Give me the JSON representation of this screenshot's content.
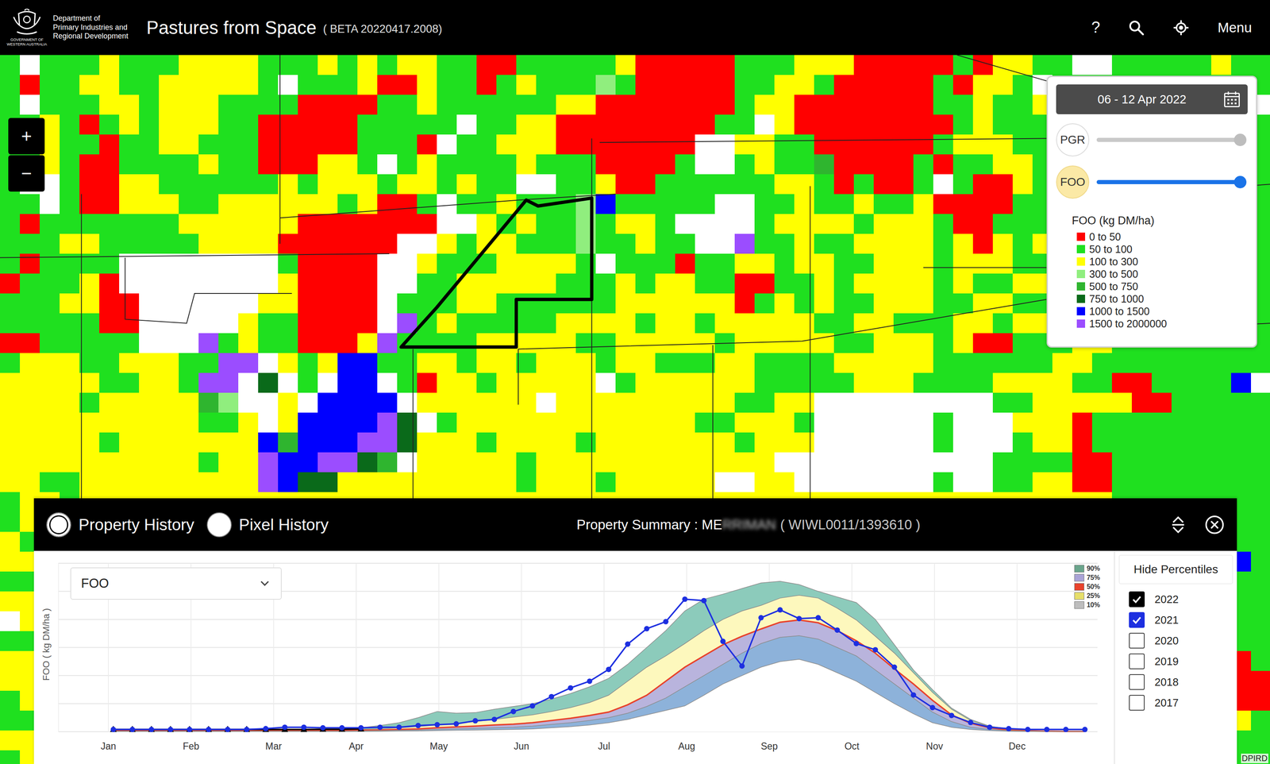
{
  "header": {
    "agency": {
      "lines": [
        "Department of",
        "Primary Industries and",
        "Regional Development"
      ],
      "government": [
        "GOVERNMENT OF",
        "WESTERN AUSTRALIA"
      ]
    },
    "title": "Pastures from Space",
    "version": "( BETA 20220417.2008)",
    "tools": {
      "help": "?",
      "menu": "Menu"
    }
  },
  "zoom": [
    "+",
    "−"
  ],
  "attribution": "DPIRD",
  "map": {
    "classes": [
      {
        "code": "r",
        "label": "0 to 50",
        "color": "#ff0000"
      },
      {
        "code": "g",
        "label": "50 to 100",
        "color": "#1fe01f"
      },
      {
        "code": "y",
        "label": "100 to 300",
        "color": "#ffff00"
      },
      {
        "code": "l",
        "label": "300 to 500",
        "color": "#90ee7e"
      },
      {
        "code": "m",
        "label": "500 to 750",
        "color": "#2fb52f"
      },
      {
        "code": "d",
        "label": "750 to 1000",
        "color": "#0a6a1a"
      },
      {
        "code": "b",
        "label": "1000 to 1500",
        "color": "#0000ff"
      },
      {
        "code": "p",
        "label": "1500 to 2000000",
        "color": "#9b4dff"
      }
    ],
    "grid": [
      "gwgggygggyyyygggygygyyggrrgggggyrrrrrgggyyyrrrrrgryyggwwgggggyggg",
      "grggyyggyyyyygwgggyrryggrgyggglgrrrrrggyygrrrrrgryygwggggggggggg",
      "gwgggyygyyyggggrrrrggyggggggyyrrrrrrrgyyrrrrrrrggyggyyggggggggg",
      "ggygrgygyyyggrrrrrgggggwggyyrrrrrrrrggwyrrrrrrrrgygggyyggggggggg",
      "gyyggrggyygggrrrrrgggrwggyyyrrrrrrrwwyyggrrrrrrgyyygggggyggggggg",
      "ggygrrggggyggrrryygwgyggggygggrrrrgwwgyggmrrrrgrggyygyyggggggggg",
      "gwwgrryyggggggygyyygyygyggwwggyrrggggggyygrgrrgwgrrygyyggggggggg",
      "ggwgrryyyggyyyyyygyrrgwggyggglbgggggwwggyggyggyrrrrggyyrggrrrggg",
      "grgggggggyyyyyyrrrrrrrwwygygglgyygwwwwgyyyygyyygrrgggyyggrrrgggg",
      "gggyygggggyyyyrrrrrrwwygyyggglggyggwwpggyggyyyygyrygyyrrgggggggg",
      "grggggwwwwwwwwgrrrrwwygggyyyygwgggrggyygyyggyyygyyygggyygggggggg",
      "rgggyrwwwwwwwwyrrrrwwggyyyyygggygyyggrrggygyyyygyggyyygggggggggg",
      "gggyyrrwwwwwwyyrrrrwgggyyggggggyyyyyyrgygyggyyyggyyggggggggggggg",
      "gggggrrwwwwwyggrrrrwpgygggggyyyygyygyyyyyggyygggyygyyggggggggbggg",
      "rrgggggwwwpgyggrrrypggggyyyyyggyyyyygyyyyyggyyygyrrgggyygggggggg",
      "gyyyggyyyggppwygybbggyygyygyyygyygggyyggggyyyyyggggggyyggggggggg",
      "yyyyyggyygppwdwgwbbwgryygyyyyywgyyyyyygggggyyyggggyyyyggrrggggb",
      "yyyygyyyyymlwwywbbbbwyyyyyywyyyyyyyyyggyywwwwwwwwwggyyyyyrrggggg",
      "yyyyyyyyyyggywybbbbpdwgyyyyyyyyyyyyggyyygwwwwwwgwwwyyyrggggggggg",
      "yyyyygyyyyyyybmbbbppdyyygyyyygyyyyyyygyyywwwwwwgwwwgyyrggggggggg",
      "yyyyyyyyyygyypbbppdmwyyyyygyyyyyyyyyyyywwwwwwwwwwwggggrrgggggggg",
      "yyggyyyyyyyyypbddyyyyyyyyygyyygyyyyywwyywwwwwwwgwwggyyrrgggggggg",
      "gyygyyyyyyyyyyyyyyyyyyyyyyyyyyyyyyyyyyyyyyyyyyyyyyyyyyyygggggggg",
      "gyygyyyyyyyyyyyyyyyyyyyyyyyyyyyyyyyyyyyyyyyyyyyyyyyyyyyyyggggrgg",
      "ygyyyyyyyyyyyyyyyyyyyyyyyyyyyyyyyyyyyyyyyyyyyyyyyyyyyyyyygggrrgg",
      "yyygyyyyyyyyyyyyyyyyyyyyyyyyyyyyyyyyyyyyyyyyyyyyyyyyyyyyyyggrrbg",
      "gggyyyyyyyyyyyyyyyyyyyyyyyyyyyyyyyyyyyyyyyyyyyyyyyyyyyyyyygggggg",
      "yyyyyyyyyyyyyyyyyyyyyyyyyyyyyyyyyyyyyyyyyyyyyyyyyyyyyyyyggyggggg",
      "wyyyyyyyyyyyyyyyyyyyyyyyyyyyyyyyyyyyyyyyyyyyyyyyyyyyyyyyyyggrggg",
      "gggyyyyyyyyyyyyyyyyyyyyyyyyyyyyyyyyyyyyyyyyyyyyyyyyyyyyyyygggggg",
      "yyggyyyyyyyyyyyyyyyyyyyyyyyyyyyyyyyyyyyyyyyyyyyyyyyyyyyyggggggrg",
      "yyyyyyyyyyyyyyyyyyyyyyyyyyyyyyyyyyyyyyyyyyyyyyyyyyyyyyyyyyyyggrr",
      "gyyyyyyyyyyyyyyyyyyyyyyyyyyyyyyyyyyyyyyyyyyyyyyyyyyyyyyyggggggrr",
      "ggyyyyyyyyyyyyyyyyyyyyyyyyyyyyyyyyyyyyyyyyyyyyyyyyyyyyyyggyyggyg",
      "yyyyyyyyyyyyyyyyyyyyyyyyyyyyyyyyyyyyyyyyyyyyyyyyyyyyyyyygggyyggg",
      "gyyyyyyyyyyyyyyyyyyyyyyyyyyyyyyyyyyyyyyyyyyyyyyyyyyyyyyygggggggg"
    ],
    "boundaries": [
      [
        [
          14.1,
          8.2
        ],
        [
          26.1,
          7.3
        ],
        [
          31.0,
          7.0
        ]
      ],
      [
        [
          0,
          10.2
        ],
        [
          19.6,
          10.0
        ]
      ],
      [
        [
          29.8,
          4.2
        ],
        [
          29.8,
          22.5
        ]
      ],
      [
        [
          26.1,
          14.8
        ],
        [
          40.4,
          14.4
        ],
        [
          52.7,
          12.3
        ]
      ],
      [
        [
          40.8,
          6.6
        ],
        [
          40.8,
          22.5
        ]
      ],
      [
        [
          30.2,
          4.4
        ],
        [
          52.7,
          4.2
        ]
      ],
      [
        [
          26.1,
          14.8
        ],
        [
          26.1,
          17.6
        ]
      ],
      [
        [
          14.1,
          0
        ],
        [
          14.1,
          9.5
        ]
      ],
      [
        [
          6.3,
          10.2
        ],
        [
          6.3,
          13.3
        ],
        [
          9.4,
          13.5
        ],
        [
          9.8,
          12.0
        ],
        [
          14.7,
          12.0
        ]
      ],
      [
        [
          46.5,
          10.7
        ],
        [
          52.7,
          10.7
        ]
      ],
      [
        [
          35.9,
          14.6
        ],
        [
          35.9,
          22.5
        ]
      ],
      [
        [
          20.8,
          14.8
        ],
        [
          20.8,
          22.5
        ]
      ],
      [
        [
          48.2,
          0
        ],
        [
          52.7,
          1.3
        ]
      ],
      [
        [
          4.1,
          7
        ],
        [
          4.1,
          22.5
        ]
      ],
      [
        [
          57.5,
          7
        ],
        [
          64,
          6.5
        ]
      ],
      [
        [
          54,
          14
        ],
        [
          64,
          13.5
        ]
      ]
    ],
    "property": [
      [
        20.2,
        14.7
      ],
      [
        22.0,
        12.7
      ],
      [
        26.5,
        7.3
      ],
      [
        27.1,
        7.6
      ],
      [
        29.8,
        7.2
      ],
      [
        29.8,
        12.3
      ],
      [
        26.0,
        12.3
      ],
      [
        26.0,
        14.7
      ]
    ]
  },
  "legend": {
    "date": "06 - 12 Apr 2022",
    "layers": [
      {
        "label": "PGR",
        "selected": false,
        "level": 1
      },
      {
        "label": "FOO",
        "selected": true,
        "level": 1
      }
    ],
    "title": "FOO (kg DM/ha)"
  },
  "panel": {
    "views": [
      {
        "label": "Property History",
        "selected": true
      },
      {
        "label": "Pixel History",
        "selected": false
      }
    ],
    "title": "Property Summary : ME",
    "redacted": "RRIMAN",
    "property_id": "( WIWL0011/1393610 )"
  },
  "chart": {
    "metric": "FOO",
    "y_label": "FOO ( kg DM/ha )",
    "x_ticks": [
      "Jan",
      "Feb",
      "Mar",
      "Apr",
      "May",
      "Jun",
      "Jul",
      "Aug",
      "Sep",
      "Oct",
      "Nov",
      "Dec"
    ],
    "toggle": "Hide Percentiles",
    "percentiles": [
      {
        "label": "90%",
        "kind": "band",
        "color": "#6aa58c",
        "fill": "#8ccbbb",
        "values": [
          40,
          40,
          40,
          40,
          40,
          40,
          40,
          40,
          40,
          40,
          40,
          40,
          40,
          70,
          110,
          160,
          250,
          360,
          330,
          340,
          400,
          450,
          500,
          580,
          680,
          800,
          950,
          1200,
          1500,
          1800,
          2150,
          2360,
          2450,
          2550,
          2650,
          2680,
          2620,
          2500,
          2400,
          2300,
          2000,
          1550,
          1100,
          750,
          420,
          220,
          100,
          50,
          25,
          12,
          6,
          6
        ]
      },
      {
        "label": "75%",
        "kind": "band",
        "color": "#a9a3d6",
        "fill": "#fdf8bd",
        "values": [
          30,
          30,
          30,
          30,
          30,
          30,
          30,
          30,
          30,
          30,
          30,
          30,
          30,
          40,
          50,
          70,
          90,
          120,
          150,
          180,
          220,
          260,
          300,
          360,
          430,
          520,
          650,
          900,
          1150,
          1350,
          1570,
          1800,
          2000,
          2150,
          2250,
          2380,
          2430,
          2380,
          2200,
          1990,
          1700,
          1400,
          1050,
          700,
          400,
          200,
          90,
          40,
          20,
          10,
          5,
          5
        ]
      },
      {
        "label": "50%",
        "kind": "median",
        "color": "#e8432c",
        "fill": "#b9b4dd",
        "values": [
          20,
          20,
          20,
          20,
          20,
          20,
          20,
          20,
          20,
          20,
          20,
          20,
          20,
          25,
          30,
          40,
          50,
          70,
          85,
          100,
          120,
          135,
          160,
          200,
          240,
          290,
          350,
          480,
          650,
          900,
          1150,
          1350,
          1550,
          1700,
          1830,
          1950,
          1990,
          1940,
          1800,
          1620,
          1400,
          1120,
          850,
          560,
          300,
          150,
          70,
          30,
          15,
          10,
          5,
          5
        ]
      },
      {
        "label": "25%",
        "kind": "band",
        "color": "#e6de6a",
        "fill": "#8db2da",
        "values": [
          10,
          10,
          10,
          10,
          10,
          10,
          10,
          10,
          10,
          10,
          10,
          10,
          10,
          15,
          20,
          25,
          30,
          40,
          50,
          60,
          70,
          80,
          100,
          130,
          160,
          200,
          250,
          330,
          450,
          600,
          800,
          1000,
          1200,
          1400,
          1570,
          1680,
          1710,
          1650,
          1500,
          1350,
          1100,
          850,
          600,
          350,
          180,
          80,
          40,
          20,
          10,
          5,
          5,
          5
        ]
      },
      {
        "label": "10%",
        "kind": "band",
        "color": "#bdbdbd",
        "fill": "#ffffff",
        "values": [
          5,
          5,
          5,
          5,
          5,
          5,
          5,
          5,
          5,
          5,
          5,
          5,
          5,
          8,
          10,
          12,
          15,
          20,
          25,
          30,
          35,
          40,
          50,
          70,
          90,
          120,
          160,
          220,
          300,
          380,
          460,
          650,
          850,
          1000,
          1150,
          1250,
          1290,
          1200,
          1050,
          900,
          700,
          500,
          320,
          160,
          80,
          40,
          20,
          10,
          5,
          5,
          5,
          5
        ]
      }
    ],
    "years": [
      {
        "label": "2022",
        "checked": true,
        "color": "#000000",
        "marker": "triangle",
        "values": [
          40,
          40,
          40,
          40,
          40,
          40,
          40,
          40,
          40,
          40,
          40,
          45,
          45,
          50
        ]
      },
      {
        "label": "2021",
        "checked": true,
        "color": "#1d2fe0",
        "marker": "circle",
        "values": [
          40,
          40,
          40,
          40,
          40,
          40,
          40,
          40,
          55,
          80,
          80,
          70,
          70,
          70,
          80,
          80,
          110,
          125,
          140,
          195,
          220,
          360,
          460,
          625,
          780,
          900,
          1110,
          1560,
          1835,
          1960,
          2360,
          2335,
          1610,
          1170,
          2030,
          2170,
          2015,
          2030,
          1810,
          1570,
          1460,
          1150,
          655,
          430,
          290,
          165,
          80,
          55,
          40,
          40,
          40,
          40
        ]
      },
      {
        "label": "2020",
        "checked": false
      },
      {
        "label": "2019",
        "checked": false
      },
      {
        "label": "2018",
        "checked": false
      },
      {
        "label": "2017",
        "checked": false
      }
    ]
  }
}
